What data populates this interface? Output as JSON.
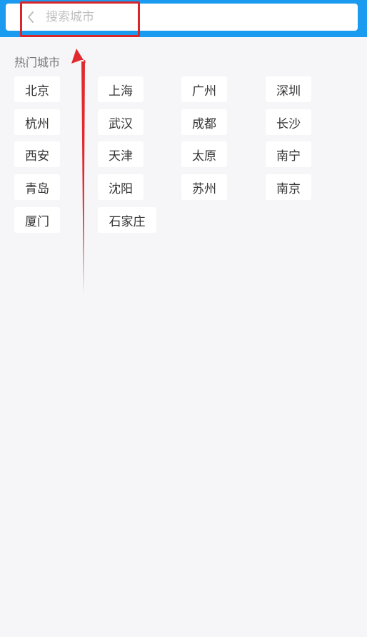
{
  "search": {
    "placeholder": "搜索城市"
  },
  "hot_cities": {
    "title": "热门城市",
    "cities": [
      "北京",
      "上海",
      "广州",
      "深圳",
      "杭州",
      "武汉",
      "成都",
      "长沙",
      "西安",
      "天津",
      "太原",
      "南宁",
      "青岛",
      "沈阳",
      "苏州",
      "南京",
      "厦门",
      "石家庄"
    ]
  },
  "colors": {
    "header_bg": "#1a9bf0",
    "page_bg": "#f6f6f8",
    "annotation": "#d9262a"
  },
  "icons": {
    "back": "chevron-left-icon"
  }
}
